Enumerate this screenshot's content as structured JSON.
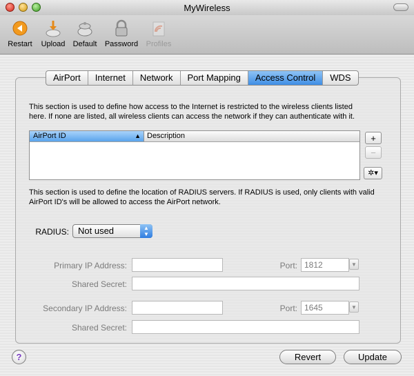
{
  "window": {
    "title": "MyWireless"
  },
  "toolbar": {
    "items": [
      {
        "label": "Restart",
        "icon": "restart-icon",
        "enabled": true
      },
      {
        "label": "Upload",
        "icon": "upload-icon",
        "enabled": true
      },
      {
        "label": "Default",
        "icon": "default-icon",
        "enabled": true
      },
      {
        "label": "Password",
        "icon": "lock-icon",
        "enabled": true
      },
      {
        "label": "Profiles",
        "icon": "profiles-icon",
        "enabled": false
      }
    ]
  },
  "tabs": [
    "AirPort",
    "Internet",
    "Network",
    "Port Mapping",
    "Access Control",
    "WDS"
  ],
  "active_tab": "Access Control",
  "access": {
    "desc_line1": "This section is used to define how access to the Internet is restricted to the wireless clients listed",
    "desc_line2": "here. If none are listed, all wireless clients can access the network if they can authenticate with it.",
    "col_id": "AirPort ID",
    "col_desc": "Description",
    "add": "+",
    "remove": "−",
    "action": "✲▾"
  },
  "radius": {
    "desc_line1": "This section is used to define the location of RADIUS servers. If RADIUS is used, only clients with valid",
    "desc_line2": "AirPort ID's will be allowed to access the AirPort network.",
    "label": "RADIUS:",
    "value": "Not used",
    "primary_ip_label": "Primary IP Address:",
    "primary_port_label": "Port:",
    "primary_port": "1812",
    "primary_secret_label": "Shared Secret:",
    "secondary_ip_label": "Secondary IP Address:",
    "secondary_port_label": "Port:",
    "secondary_port": "1645",
    "secondary_secret_label": "Shared Secret:"
  },
  "footer": {
    "help": "?",
    "revert": "Revert",
    "update": "Update"
  },
  "colors": {
    "accent": "#3f8ee5",
    "help": "#7a3ec2"
  }
}
